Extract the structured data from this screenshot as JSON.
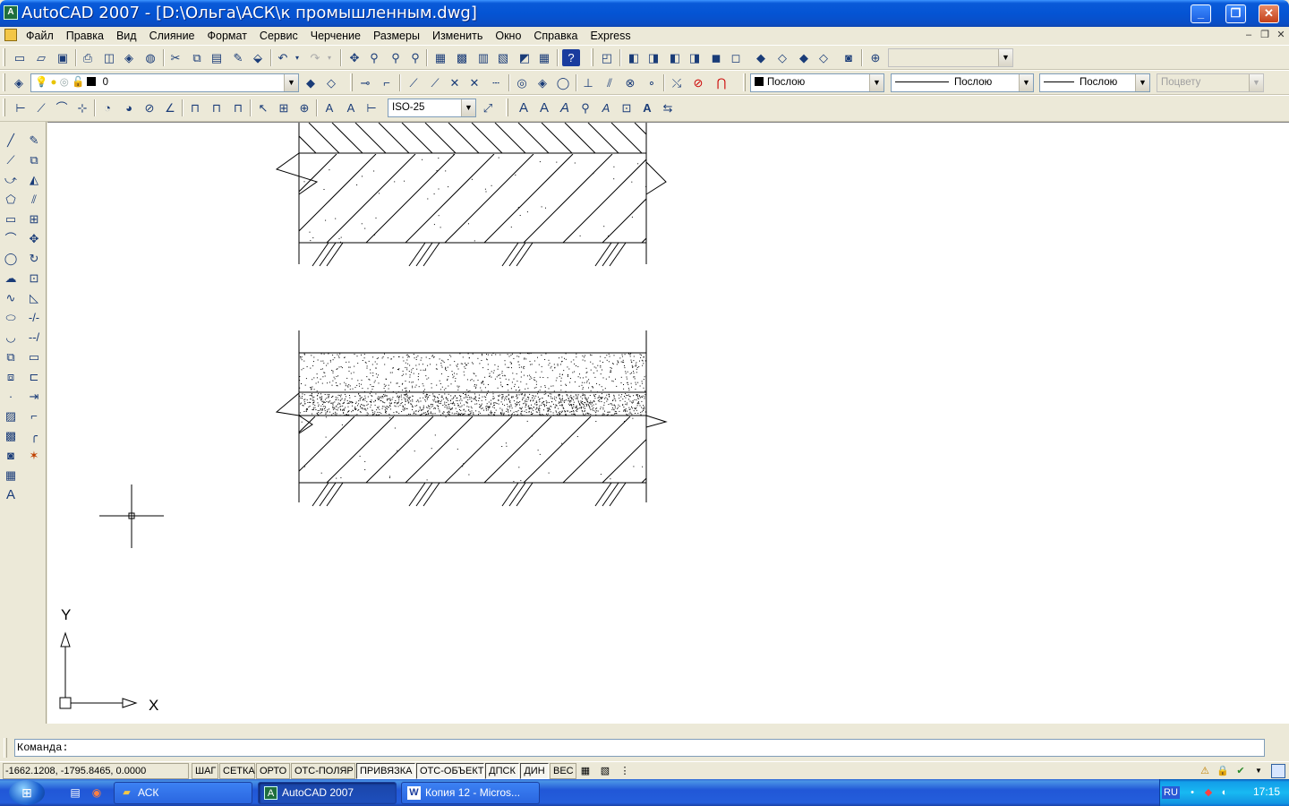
{
  "titlebar": {
    "title": "AutoCAD 2007 - [D:\\Ольга\\АСК\\к промышленным.dwg]",
    "min_glyph": "_",
    "max_glyph": "❐",
    "close_glyph": "✕"
  },
  "menu": {
    "items": [
      "Файл",
      "Правка",
      "Вид",
      "Слияние",
      "Формат",
      "Сервис",
      "Черчение",
      "Размеры",
      "Изменить",
      "Окно",
      "Справка",
      "Express"
    ]
  },
  "toolbars": {
    "layer_value": "0",
    "dimstyle_value": "ISO-25",
    "color_value": "Послою",
    "linetype_value": "Послою",
    "lineweight_value": "Послою",
    "plotstyle_value": "Поцвету"
  },
  "command": {
    "prompt": "Команда:"
  },
  "statusbar": {
    "coords": "-1662.1208, -1795.8465, 0.0000",
    "buttons": [
      "ШАГ",
      "СЕТКА",
      "ОРТО",
      "ОТС-ПОЛЯР",
      "ПРИВЯЗКА",
      "ОТС-ОБЪЕКТ",
      "ДПСК",
      "ДИН",
      "ВЕС"
    ]
  },
  "ucs": {
    "x_label": "X",
    "y_label": "Y"
  },
  "taskbar": {
    "tasks": [
      "АСК",
      "AutoCAD 2007",
      "Копия 12 - Micros..."
    ],
    "lang": "RU",
    "clock": "17:15"
  },
  "colors": {
    "titlebar": "#0454d4",
    "taskbar": "#245edb",
    "canvas": "#ffffff",
    "chrome": "#ece9d8"
  }
}
